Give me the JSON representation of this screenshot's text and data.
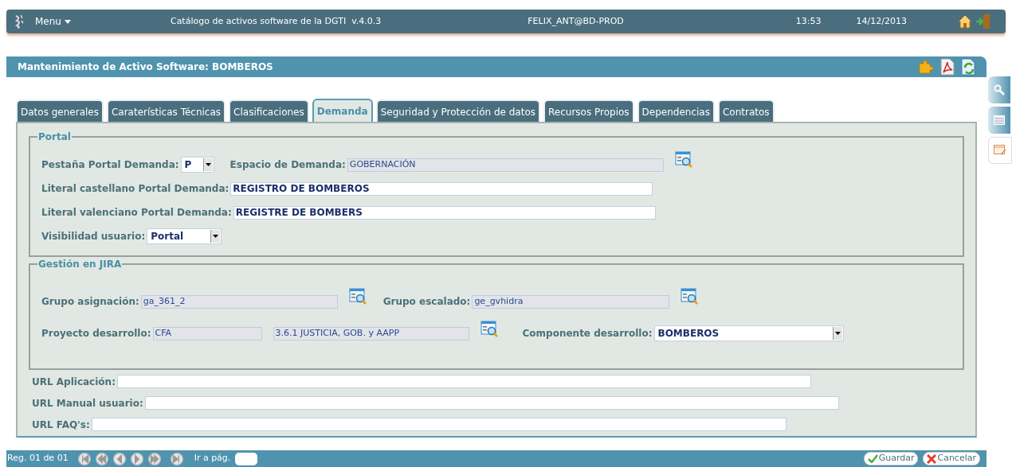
{
  "header": {
    "menu": "Menu",
    "app_title": "Catálogo de activos software de la DGTI  v.4.0.3",
    "user": "FELIX_ANT@BD-PROD",
    "time": "13:53",
    "date": "14/12/2013"
  },
  "title": "Mantenimiento de Activo Software: BOMBEROS",
  "tabs": [
    {
      "label": "Datos generales",
      "selected": false
    },
    {
      "label": "Caraterísticas Técnicas",
      "selected": false
    },
    {
      "label": "Clasificaciones",
      "selected": false
    },
    {
      "label": "Demanda",
      "selected": true
    },
    {
      "label": "Seguridad y Protección de datos",
      "selected": false
    },
    {
      "label": "Recursos Propios",
      "selected": false
    },
    {
      "label": "Dependencias",
      "selected": false
    },
    {
      "label": "Contratos",
      "selected": false
    }
  ],
  "sections": [
    {
      "legend": "Portal",
      "rows": [
        {
          "fields": [
            {
              "label": "Pestaña Portal Demanda:",
              "kind": "select",
              "value": "P",
              "lookup": false
            },
            {
              "label": "Espacio de Demanda:",
              "kind": "readonly",
              "value": "GOBERNACIÓN",
              "lookup": true
            }
          ]
        },
        {
          "fields": [
            {
              "label": "Literal castellano Portal Demanda:",
              "kind": "text",
              "value": "REGISTRO DE BOMBEROS",
              "lookup": false
            }
          ]
        },
        {
          "fields": [
            {
              "label": "Literal valenciano Portal Demanda:",
              "kind": "text",
              "value": "REGISTRE DE BOMBERS",
              "lookup": false
            }
          ]
        },
        {
          "fields": [
            {
              "label": "Visibilidad usuario:",
              "kind": "select",
              "value": "Portal",
              "lookup": false
            }
          ]
        }
      ]
    },
    {
      "legend": "Gestión en JIRA",
      "rows": [
        {
          "fields": [
            {
              "label": "Grupo asignación:",
              "kind": "readonly",
              "value": "ga_361_2",
              "lookup": true
            },
            {
              "label": "Grupo escalado:",
              "kind": "readonly",
              "value": "ge_gvhidra",
              "lookup": true
            }
          ]
        },
        {
          "fields": [
            {
              "label": "Proyecto desarrollo:",
              "kind": "readonly",
              "value": "CFA",
              "lookup": false
            },
            {
              "kind": "readonly",
              "value": "3.6.1 JUSTICIA, GOB. y AAPP",
              "lookup": true
            },
            {
              "label": "Componente desarrollo:",
              "kind": "select",
              "value": "BOMBEROS",
              "lookup": false
            }
          ]
        }
      ]
    }
  ],
  "url_fields": [
    {
      "label": "URL Aplicación:"
    },
    {
      "label": "URL Manual usuario:"
    },
    {
      "label": "URL FAQ's:"
    }
  ],
  "footer": {
    "record": "Reg. 01 de 01",
    "goto": "Ir a pág.",
    "buttons": [
      "Guardar",
      "Cancelar"
    ]
  }
}
